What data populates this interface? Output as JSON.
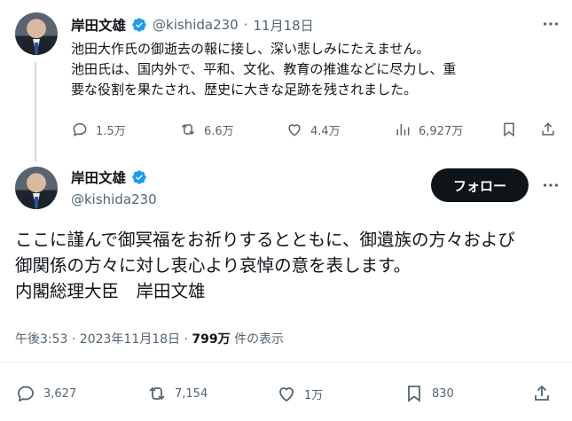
{
  "reply_tweet": {
    "name": "岸田文雄",
    "handle": "@kishida230",
    "separator": "·",
    "date": "11月18日",
    "line1": "池田大作氏の御逝去の報に接し、深い悲しみにたえません。",
    "line2": "池田氏は、国内外で、平和、文化、教育の推進などに尽力し、重",
    "line3": "要な役割を果たされ、歴史に大きな足跡を残されました。",
    "replies": "1.5万",
    "reposts": "6.6万",
    "likes": "4.4万",
    "views": "6,927万"
  },
  "main_tweet": {
    "name": "岸田文雄",
    "handle": "@kishida230",
    "follow_label": "フォロー",
    "line1": "ここに謹んで御冥福をお祈りするとともに、御遺族の方々および",
    "line2": "御関係の方々に対し衷心より哀悼の意を表します。",
    "line3": "内閣総理大臣　岸田文雄",
    "timestamp": "午後3:53 · 2023年11月18日 · ",
    "view_count": "799万",
    "view_label": " 件の表示",
    "replies": "3,627",
    "reposts": "7,154",
    "likes": "1万",
    "bookmarks": "830"
  },
  "colors": {
    "verified": "#1d9bf0",
    "text": "#0f1419",
    "muted": "#536471"
  },
  "icons": [
    "reply-icon",
    "repost-icon",
    "like-icon",
    "views-icon",
    "bookmark-icon",
    "share-icon",
    "verified-icon",
    "more-icon"
  ]
}
